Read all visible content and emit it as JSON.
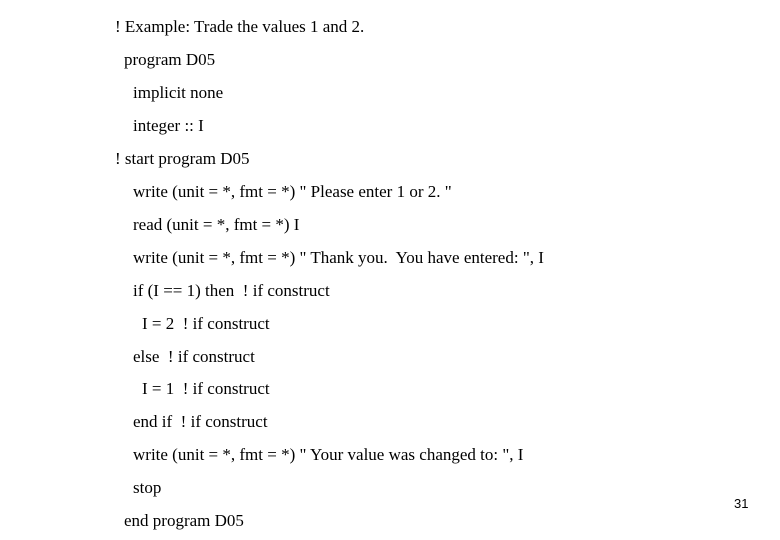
{
  "slide": {
    "lines": [
      "! Example: Trade the values 1 and 2.",
      "program D05",
      "implicit none",
      "integer :: I",
      "! start program D05",
      "write (unit = *, fmt = *) \" Please enter 1 or 2. \"",
      "read (unit = *, fmt = *) I",
      "write (unit = *, fmt = *) \" Thank you.  You have entered: \", I",
      "if (I == 1) then  ! if construct",
      "I = 2  ! if construct",
      "else  ! if construct",
      "I = 1  ! if construct",
      "end if  ! if construct",
      "write (unit = *, fmt = *) \" Your value was changed to: \", I",
      "stop",
      "end program D05"
    ],
    "page_number": "31"
  }
}
